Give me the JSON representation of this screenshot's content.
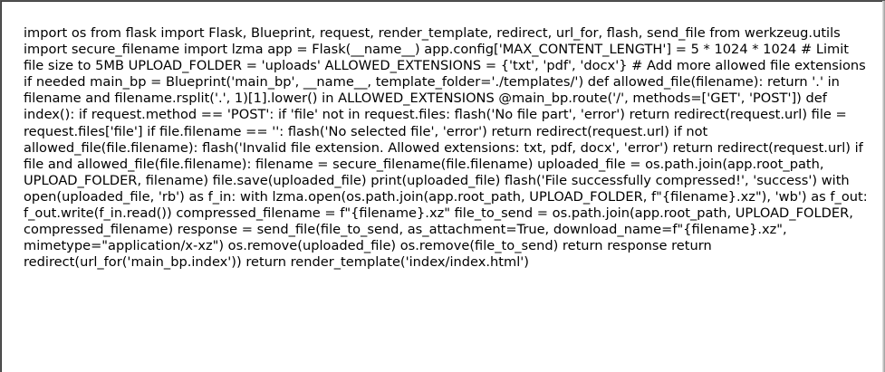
{
  "document": {
    "code_text": "import os from flask import Flask, Blueprint, request, render_template, redirect, url_for, flash, send_file from werkzeug.utils import secure_filename import lzma app = Flask(__name__) app.config['MAX_CONTENT_LENGTH'] = 5 * 1024 * 1024 # Limit file size to 5MB UPLOAD_FOLDER = 'uploads' ALLOWED_EXTENSIONS = {'txt', 'pdf', 'docx'} # Add more allowed file extensions if needed main_bp = Blueprint('main_bp', __name__, template_folder='./templates/') def allowed_file(filename): return '.' in filename and filename.rsplit('.', 1)[1].lower() in ALLOWED_EXTENSIONS @main_bp.route('/', methods=['GET', 'POST']) def index(): if request.method == 'POST': if 'file' not in request.files: flash('No file part', 'error') return redirect(request.url) file = request.files['file'] if file.filename == '': flash('No selected file', 'error') return redirect(request.url) if not allowed_file(file.filename): flash('Invalid file extension. Allowed extensions: txt, pdf, docx', 'error') return redirect(request.url) if file and allowed_file(file.filename): filename = secure_filename(file.filename) uploaded_file = os.path.join(app.root_path, UPLOAD_FOLDER, filename) file.save(uploaded_file) print(uploaded_file) flash('File successfully compressed!', 'success') with open(uploaded_file, 'rb') as f_in: with lzma.open(os.path.join(app.root_path, UPLOAD_FOLDER, f\"{filename}.xz\"), 'wb') as f_out: f_out.write(f_in.read()) compressed_filename = f\"{filename}.xz\" file_to_send = os.path.join(app.root_path, UPLOAD_FOLDER, compressed_filename) response = send_file(file_to_send, as_attachment=True, download_name=f\"{filename}.xz\", mimetype=\"application/x-xz\") os.remove(uploaded_file) os.remove(file_to_send) return response return redirect(url_for('main_bp.index')) return render_template('index/index.html')"
  }
}
